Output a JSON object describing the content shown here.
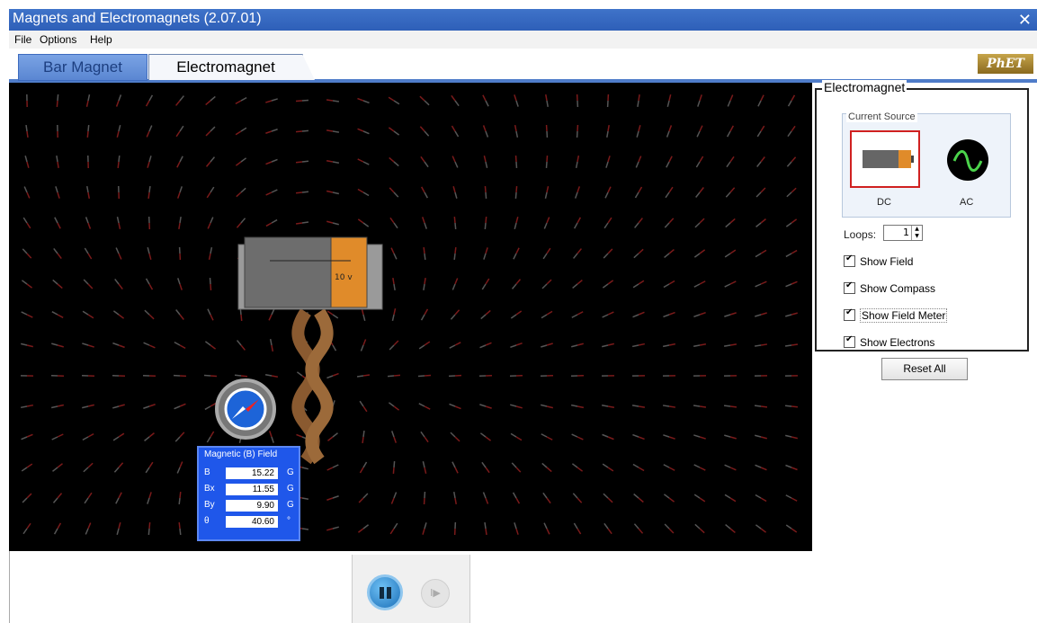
{
  "window": {
    "title": "Magnets and Electromagnets (2.07.01)",
    "close_symbol": "✕"
  },
  "menu": {
    "file": "File",
    "options": "Options",
    "help": "Help"
  },
  "tabs": {
    "bar_magnet": "Bar Magnet",
    "electromagnet": "Electromagnet"
  },
  "logo": "PhET",
  "battery": {
    "label": "10 v"
  },
  "panel": {
    "title": "Electromagnet",
    "current_source": "Current Source",
    "dc_label": "DC",
    "ac_label": "AC",
    "loops_label": "Loops:",
    "loops_value": "1",
    "show_field": "Show Field",
    "show_compass": "Show Compass",
    "show_field_meter": "Show Field Meter",
    "show_electrons": "Show Electrons",
    "reset": "Reset All"
  },
  "meter": {
    "title": "Magnetic (B) Field",
    "rows": [
      {
        "key": "B",
        "value": "15.22",
        "unit": "G"
      },
      {
        "key": "Bx",
        "value": "11.55",
        "unit": "G"
      },
      {
        "key": "By",
        "value": "9.90",
        "unit": "G"
      },
      {
        "key": "θ",
        "value": "40.60",
        "unit": "°"
      }
    ]
  },
  "controls": {
    "step_symbol": "I▶"
  },
  "colors": {
    "title_bar": "#2e5fb8",
    "meter_bg": "#1f57ea",
    "selected_border": "#d02020",
    "canvas_bg": "#000000"
  }
}
